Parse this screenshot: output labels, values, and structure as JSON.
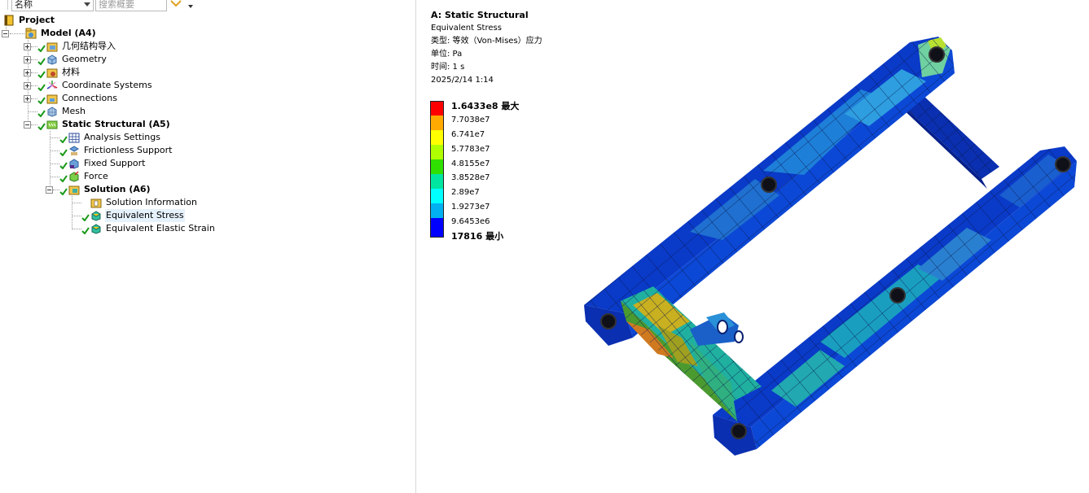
{
  "toolbar": {
    "name_dropdown": "名称",
    "search_placeholder": "搜索概要"
  },
  "tree": {
    "project": "Project",
    "model": "Model (A4)",
    "geometry_import": "几何结构导入",
    "geometry": "Geometry",
    "materials": "材料",
    "coordinate_systems": "Coordinate Systems",
    "connections": "Connections",
    "mesh": "Mesh",
    "static_structural": "Static Structural (A5)",
    "analysis_settings": "Analysis Settings",
    "frictionless_support": "Frictionless Support",
    "fixed_support": "Fixed Support",
    "force": "Force",
    "solution": "Solution (A6)",
    "solution_information": "Solution Information",
    "equivalent_stress": "Equivalent Stress",
    "equivalent_elastic_strain": "Equivalent Elastic Strain"
  },
  "viewport": {
    "title": "A: Static Structural",
    "result_name": "Equivalent Stress",
    "type_line": "类型: 等效（Von-Mises）应力",
    "unit_line": "单位: Pa",
    "time_line": "时间: 1 s",
    "date_line": "2025/2/14 1:14"
  },
  "legend": {
    "max_label": "1.6433e8 最大",
    "min_label": "17816 最小",
    "levels": [
      "7.7038e7",
      "6.741e7",
      "5.7783e7",
      "4.8155e7",
      "3.8528e7",
      "2.89e7",
      "1.9273e7",
      "9.6453e6"
    ],
    "colors": [
      "#ff0000",
      "#ffaa00",
      "#ffff00",
      "#b0ff00",
      "#30e000",
      "#00e5a0",
      "#00ffff",
      "#00b0f0",
      "#0000ff"
    ]
  }
}
